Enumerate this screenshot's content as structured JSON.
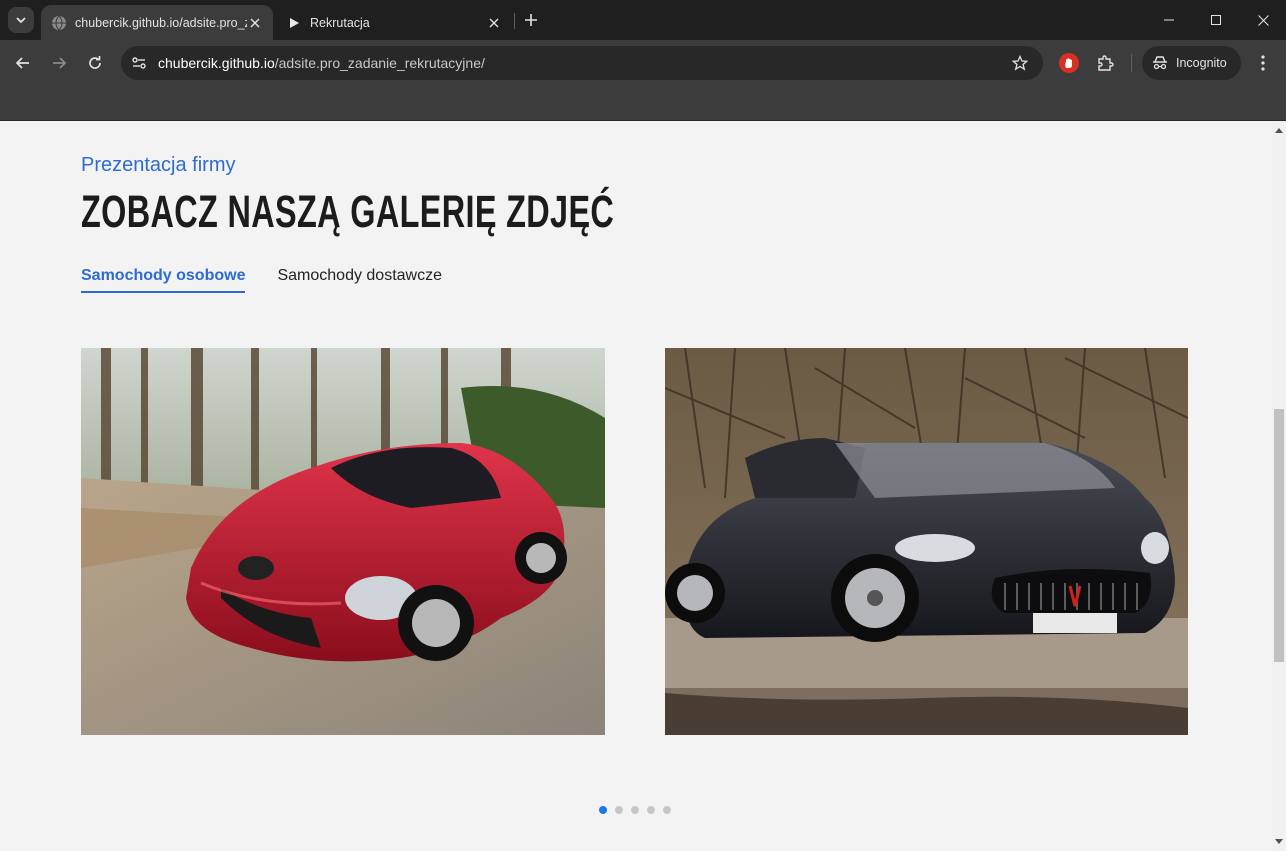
{
  "browser": {
    "tabs": [
      {
        "title": "chubercik.github.io/adsite.pro_z",
        "active": true
      },
      {
        "title": "Rekrutacja",
        "active": false
      }
    ],
    "url_host": "chubercik.github.io",
    "url_path": "/adsite.pro_zadanie_rekrutacyjne/",
    "incognito_label": "Incognito"
  },
  "page": {
    "subtitle": "Prezentacja firmy",
    "heading": "ZOBACZ NASZĄ GALERIĘ ZDJĘĆ",
    "tabs": [
      {
        "label": "Samochody osobowe",
        "active": true
      },
      {
        "label": "Samochody dostawcze",
        "active": false
      }
    ],
    "gallery": [
      {
        "subject": "red sports car on forest road"
      },
      {
        "subject": "black convertible sports car"
      }
    ],
    "pagination": {
      "total": 5,
      "current": 1
    }
  },
  "colors": {
    "accent": "#2e6bd1",
    "dot_active": "#1e78e6",
    "chrome_dark": "#1f1f1f",
    "chrome_mid": "#3c3c3c"
  }
}
